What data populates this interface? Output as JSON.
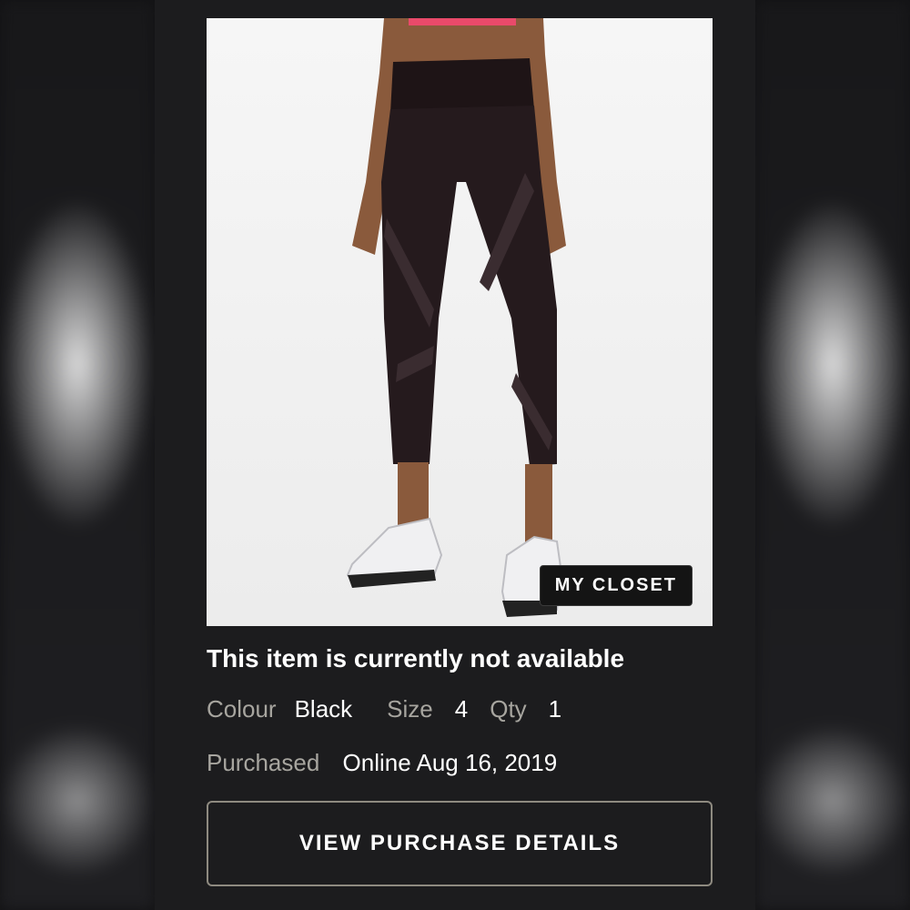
{
  "product": {
    "image_icon": "product-photo-leggings",
    "badge_label": "MY CLOSET",
    "availability": "This item is currently not available"
  },
  "attributes": {
    "colour_label": "Colour",
    "colour_value": "Black",
    "size_label": "Size",
    "size_value": "4",
    "qty_label": "Qty",
    "qty_value": "1"
  },
  "purchase": {
    "label": "Purchased",
    "value": "Online Aug 16, 2019"
  },
  "actions": {
    "details_button": "VIEW PURCHASE DETAILS"
  },
  "colors": {
    "background": "#1c1c1e",
    "text_primary": "#ffffff",
    "text_secondary": "#a7a59f",
    "button_border": "#8e8a80"
  }
}
